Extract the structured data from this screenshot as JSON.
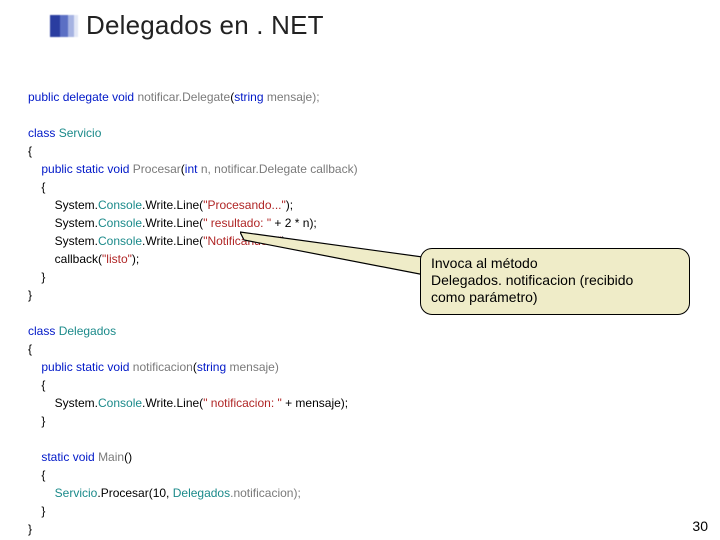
{
  "slide": {
    "title": "Delegados en . NET",
    "page_number": "30"
  },
  "code": {
    "dlg_decl": {
      "kw1": "public",
      "kw2": "delegate",
      "kw3": "void",
      "name": "notificar.Delegate",
      "sig": "(",
      "ptype": "string",
      "pname": " mensaje);"
    },
    "class1": {
      "kw": "class",
      "name": "Servicio",
      "ob": "{",
      "cb": "}"
    },
    "procesar": {
      "kw1": "public",
      "kw2": "static",
      "kw3": "void",
      "name": "Procesar",
      "sig_open": "(",
      "p1t": "int",
      "p1n": " n, ",
      "p2t": "notificar.Delegate",
      "p2n": " callback)",
      "ob": "{",
      "l1a": "System.",
      "l1b": "Console",
      "l1c": ".Write.Line(",
      "l1s": "\"Procesando...\"",
      "l1d": ");",
      "l2a": "System.",
      "l2b": "Console",
      "l2c": ".Write.Line(",
      "l2s": "\" resultado: \"",
      "l2d": " + 2 * n);",
      "l3a": "System.",
      "l3b": "Console",
      "l3c": ".Write.Line(",
      "l3s": "\"Notificando...\"",
      "l3d": ");",
      "l4a": "callback(",
      "l4s": "\"listo\"",
      "l4b": ");",
      "cb": "}"
    },
    "class2": {
      "kw": "class",
      "name": "Delegados",
      "ob": "{",
      "cb": "}"
    },
    "notif": {
      "kw1": "public",
      "kw2": "static",
      "kw3": "void",
      "name": "notificacion",
      "sig_open": "(",
      "pt": "string",
      "pn": " mensaje)",
      "ob": "{",
      "la": "System.",
      "lb": "Console",
      "lc": ".Write.Line(",
      "ls": "\" notificacion: \"",
      "ld": " + mensaje);",
      "cb": "}"
    },
    "main": {
      "kw1": "static",
      "kw2": "void",
      "name": "Main",
      "sig": "()",
      "ob": "{",
      "la": "Servicio",
      "lb": ".Procesar(10, ",
      "lc": "Delegados",
      "ld": ".notificacion);",
      "cb": "}"
    }
  },
  "callout": {
    "line1": " Invoca al método",
    "line2": "Delegados. notificacion (recibido",
    "line3": "como parámetro)"
  }
}
